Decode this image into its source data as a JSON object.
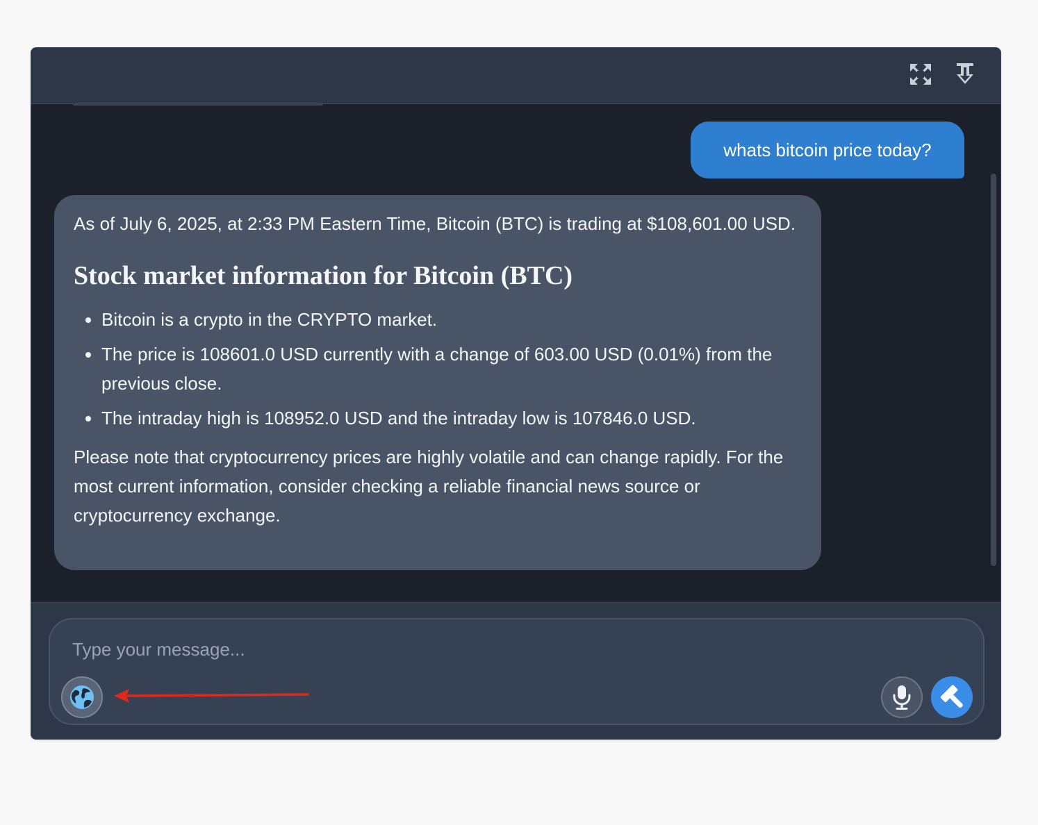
{
  "header": {
    "expand_icon": "expand-arrows-icon",
    "pin_icon": "pin-down-icon"
  },
  "messages": {
    "user": {
      "text": "whats bitcoin price today?"
    },
    "assistant": {
      "intro": "As of July 6, 2025, at 2:33 PM Eastern Time, Bitcoin (BTC) is trading at $108,601.00 USD.",
      "heading": "Stock market information for Bitcoin (BTC)",
      "bullets": [
        "Bitcoin is a crypto in the CRYPTO market.",
        "The price is 108601.0 USD currently with a change of 603.00 USD (0.01%) from the previous close.",
        "The intraday high is 108952.0 USD and the intraday low is 107846.0 USD."
      ],
      "note": "Please note that cryptocurrency prices are highly volatile and can change rapidly. For the most current information, consider checking a reliable financial news source or cryptocurrency exchange."
    }
  },
  "composer": {
    "placeholder": "Type your message...",
    "value": "",
    "globe_icon": "globe-icon",
    "mic_icon": "microphone-icon",
    "send_icon": "hammer-icon"
  },
  "colors": {
    "user_bubble": "#2f7fd0",
    "assistant_bubble": "#4a5467",
    "send_button": "#3b8ee8",
    "annotation_arrow": "#e0281c"
  }
}
